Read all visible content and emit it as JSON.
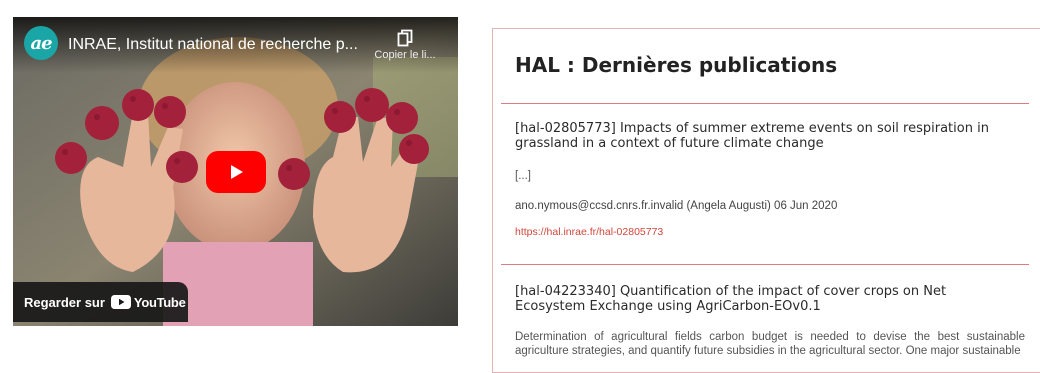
{
  "video": {
    "channel_avatar_text": "ae",
    "title": "INRAE, Institut national de recherche p...",
    "copy_label": "Copier le li...",
    "watch_label": "Regarder sur",
    "youtube_label": "YouTube",
    "play_color": "#ff0000"
  },
  "hal": {
    "heading": "HAL : Dernières publications",
    "accent_color": "#d87e7e",
    "publications": [
      {
        "title": "[hal-02805773] Impacts of summer extreme events on soil respiration in grassland in a context of future climate change",
        "excerpt": "[...]",
        "author_line": "ano.nymous@ccsd.cnrs.fr.invalid (Angela Augusti) 06 Jun 2020",
        "link": "https://hal.inrae.fr/hal-02805773"
      },
      {
        "title": "[hal-04223340] Quantification of the impact of cover crops on Net Ecosystem Exchange using AgriCarbon-EOv0.1",
        "abstract": "Determination of agricultural fields carbon budget is needed to devise the best sustainable agriculture strategies, and quantify future subsidies in the agricultural sector. One major sustainable"
      }
    ]
  }
}
